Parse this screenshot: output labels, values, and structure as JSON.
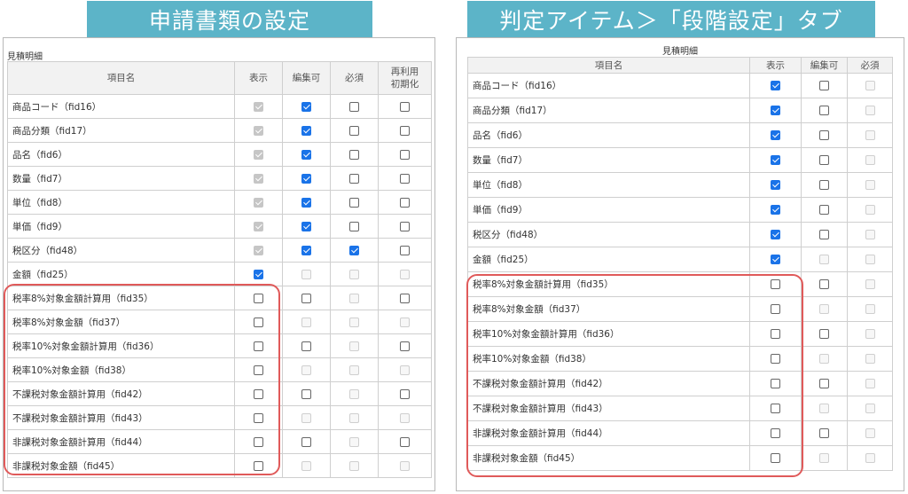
{
  "left": {
    "banner": "申請書類の設定",
    "section_label": "見積明細",
    "headers": [
      "項目名",
      "表示",
      "編集可",
      "必須",
      "再利用\n初期化"
    ],
    "rows": [
      {
        "name": "商品コード（fid16）",
        "cells": [
          [
            "checked",
            "disabled"
          ],
          [
            "checked"
          ],
          [],
          []
        ]
      },
      {
        "name": "商品分類（fid17）",
        "cells": [
          [
            "checked",
            "disabled"
          ],
          [
            "checked"
          ],
          [],
          []
        ]
      },
      {
        "name": "品名（fid6）",
        "cells": [
          [
            "checked",
            "disabled"
          ],
          [
            "checked"
          ],
          [],
          []
        ]
      },
      {
        "name": "数量（fid7）",
        "cells": [
          [
            "checked",
            "disabled"
          ],
          [
            "checked"
          ],
          [],
          []
        ]
      },
      {
        "name": "単位（fid8）",
        "cells": [
          [
            "checked",
            "disabled"
          ],
          [
            "checked"
          ],
          [],
          []
        ]
      },
      {
        "name": "単価（fid9）",
        "cells": [
          [
            "checked",
            "disabled"
          ],
          [
            "checked"
          ],
          [],
          []
        ]
      },
      {
        "name": "税区分（fid48）",
        "cells": [
          [
            "checked",
            "disabled"
          ],
          [
            "checked"
          ],
          [
            "checked"
          ],
          []
        ]
      },
      {
        "name": "金額（fid25）",
        "cells": [
          [
            "checked"
          ],
          [
            "disabled"
          ],
          [
            "disabled"
          ],
          [
            "disabled"
          ]
        ]
      },
      {
        "name": "税率8%対象金額計算用（fid35）",
        "cells": [
          [],
          [],
          [
            "disabled"
          ],
          []
        ]
      },
      {
        "name": "税率8%対象金額（fid37）",
        "cells": [
          [],
          [
            "disabled"
          ],
          [
            "disabled"
          ],
          [
            "disabled"
          ]
        ]
      },
      {
        "name": "税率10%対象金額計算用（fid36）",
        "cells": [
          [],
          [],
          [
            "disabled"
          ],
          []
        ]
      },
      {
        "name": "税率10%対象金額（fid38）",
        "cells": [
          [],
          [
            "disabled"
          ],
          [
            "disabled"
          ],
          [
            "disabled"
          ]
        ]
      },
      {
        "name": "不課税対象金額計算用（fid42）",
        "cells": [
          [],
          [],
          [
            "disabled"
          ],
          []
        ]
      },
      {
        "name": "不課税対象金額計算用（fid43）",
        "cells": [
          [],
          [
            "disabled"
          ],
          [
            "disabled"
          ],
          [
            "disabled"
          ]
        ]
      },
      {
        "name": "非課税対象金額計算用（fid44）",
        "cells": [
          [],
          [],
          [
            "disabled"
          ],
          []
        ]
      },
      {
        "name": "非課税対象金額（fid45）",
        "cells": [
          [],
          [
            "disabled"
          ],
          [
            "disabled"
          ],
          [
            "disabled"
          ]
        ]
      }
    ]
  },
  "right": {
    "banner": "判定アイテム＞「段階設定」タブ",
    "section_label": "見積明細",
    "headers": [
      "項目名",
      "表示",
      "編集可",
      "必須"
    ],
    "rows": [
      {
        "name": "商品コード（fid16）",
        "cells": [
          [
            "checked"
          ],
          [],
          [
            "disabled"
          ]
        ]
      },
      {
        "name": "商品分類（fid17）",
        "cells": [
          [
            "checked"
          ],
          [],
          [
            "disabled"
          ]
        ]
      },
      {
        "name": "品名（fid6）",
        "cells": [
          [
            "checked"
          ],
          [],
          [
            "disabled"
          ]
        ]
      },
      {
        "name": "数量（fid7）",
        "cells": [
          [
            "checked"
          ],
          [],
          [
            "disabled"
          ]
        ]
      },
      {
        "name": "単位（fid8）",
        "cells": [
          [
            "checked"
          ],
          [],
          [
            "disabled"
          ]
        ]
      },
      {
        "name": "単価（fid9）",
        "cells": [
          [
            "checked"
          ],
          [],
          [
            "disabled"
          ]
        ]
      },
      {
        "name": "税区分（fid48）",
        "cells": [
          [
            "checked"
          ],
          [],
          [
            "disabled"
          ]
        ]
      },
      {
        "name": "金額（fid25）",
        "cells": [
          [
            "checked"
          ],
          [
            "disabled"
          ],
          [
            "disabled"
          ]
        ]
      },
      {
        "name": "税率8%対象金額計算用（fid35）",
        "cells": [
          [],
          [],
          [
            "disabled"
          ]
        ]
      },
      {
        "name": "税率8%対象金額（fid37）",
        "cells": [
          [],
          [
            "disabled"
          ],
          [
            "disabled"
          ]
        ]
      },
      {
        "name": "税率10%対象金額計算用（fid36）",
        "cells": [
          [],
          [],
          [
            "disabled"
          ]
        ]
      },
      {
        "name": "税率10%対象金額（fid38）",
        "cells": [
          [],
          [
            "disabled"
          ],
          [
            "disabled"
          ]
        ]
      },
      {
        "name": "不課税対象金額計算用（fid42）",
        "cells": [
          [],
          [],
          [
            "disabled"
          ]
        ]
      },
      {
        "name": "不課税対象金額計算用（fid43）",
        "cells": [
          [],
          [
            "disabled"
          ],
          [
            "disabled"
          ]
        ]
      },
      {
        "name": "非課税対象金額計算用（fid44）",
        "cells": [
          [],
          [],
          [
            "disabled"
          ]
        ]
      },
      {
        "name": "非課税対象金額（fid45）",
        "cells": [
          [],
          [
            "disabled"
          ],
          [
            "disabled"
          ]
        ]
      }
    ]
  },
  "colors": {
    "banner": "#5cb4c8",
    "highlight": "#e05a5a",
    "checkbox_checked": "#1a73e8"
  }
}
